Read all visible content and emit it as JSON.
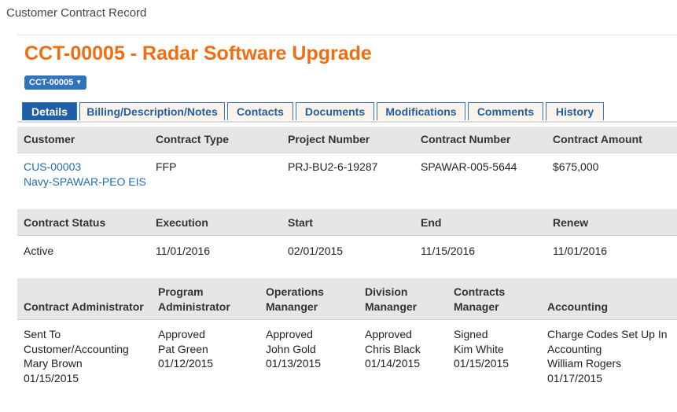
{
  "app": {
    "title": "Customer Contract Record"
  },
  "record": {
    "title": "CCT-00005 - Radar Software Upgrade",
    "id_button": "CCT-00005"
  },
  "tabs": [
    {
      "label": "Details",
      "active": true
    },
    {
      "label": "Billing/Description/Notes",
      "active": false
    },
    {
      "label": "Contacts",
      "active": false
    },
    {
      "label": "Documents",
      "active": false
    },
    {
      "label": "Modifications",
      "active": false
    },
    {
      "label": "Comments",
      "active": false
    },
    {
      "label": "History",
      "active": false
    }
  ],
  "section1": {
    "headers": [
      "Customer",
      "Contract Type",
      "Project Number",
      "Contract Number",
      "Contract Amount"
    ],
    "customer_id": "CUS-00003",
    "customer_name": "Navy-SPAWAR-PEO EIS",
    "contract_type": "FFP",
    "project_number": "PRJ-BU2-6-19287",
    "contract_number": "SPAWAR-005-5644",
    "contract_amount": "$675,000"
  },
  "section2": {
    "headers": [
      "Contract Status",
      "Execution",
      "Start",
      "End",
      "Renew"
    ],
    "values": [
      "Active",
      "11/01/2016",
      "02/01/2015",
      "11/15/2016",
      "11/01/2016"
    ]
  },
  "section3": {
    "headers": [
      {
        "line1": "",
        "line2": "Contract Administrator"
      },
      {
        "line1": "Program",
        "line2": "Administrator"
      },
      {
        "line1": "Operations",
        "line2": "Mananger"
      },
      {
        "line1": "Division",
        "line2": "Mananger"
      },
      {
        "line1": "Contracts",
        "line2": "Manager"
      },
      {
        "line1": "",
        "line2": "Accounting"
      }
    ],
    "values": [
      {
        "l1": "Sent To",
        "l2": "Customer/Accounting",
        "l3": "Mary Brown",
        "l4": "01/15/2015"
      },
      {
        "l1": "Approved",
        "l2": "Pat Green",
        "l3": "01/12/2015",
        "l4": ""
      },
      {
        "l1": "Approved",
        "l2": "John Gold",
        "l3": "01/13/2015",
        "l4": ""
      },
      {
        "l1": "Approved",
        "l2": "Chris Black",
        "l3": "01/14/2015",
        "l4": ""
      },
      {
        "l1": "Signed",
        "l2": "Kim White",
        "l3": "01/15/2015",
        "l4": ""
      },
      {
        "l1": "Charge Codes Set Up In",
        "l2": "Accounting",
        "l3": "William Rogers",
        "l4": "01/17/2015"
      }
    ]
  }
}
